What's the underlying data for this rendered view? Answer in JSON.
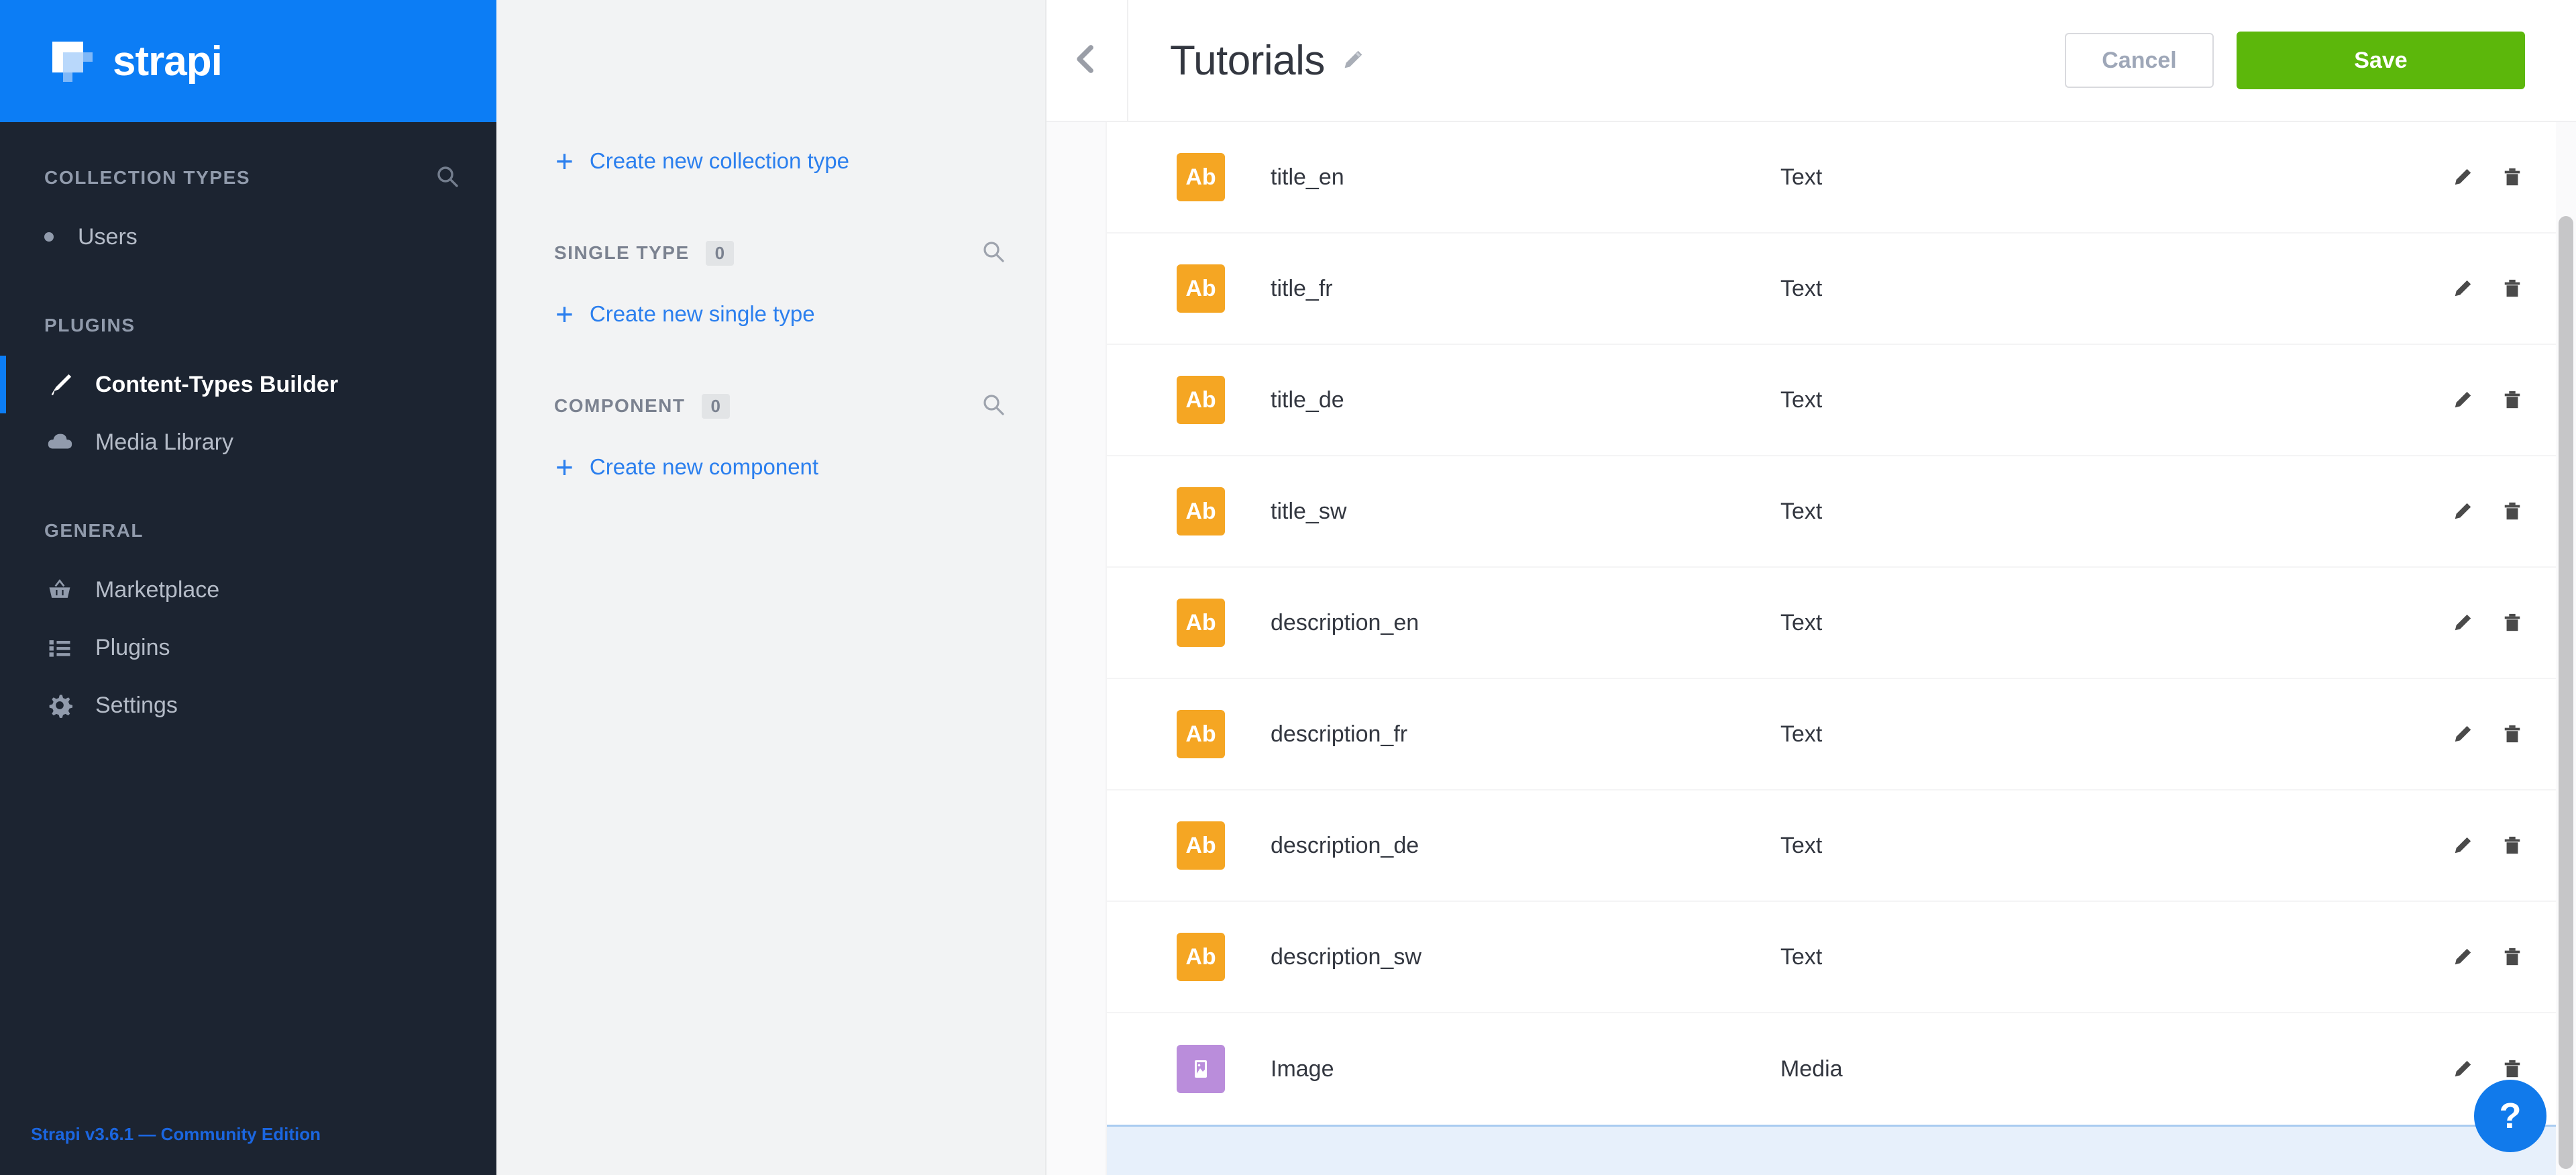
{
  "brand": {
    "name": "strapi",
    "logo_icon": "strapi-logo-icon",
    "header_color": "#0c7df5"
  },
  "sidebar": {
    "background": "#1c2431",
    "sections": [
      {
        "title": "COLLECTION TYPES",
        "search_icon": "search-icon",
        "items": [
          {
            "label": "Users",
            "icon": "bullet-dot-icon",
            "active": false
          }
        ]
      },
      {
        "title": "PLUGINS",
        "search_icon": null,
        "items": [
          {
            "label": "Content-Types Builder",
            "icon": "paintbrush-icon",
            "active": true
          },
          {
            "label": "Media Library",
            "icon": "cloud-upload-icon",
            "active": false
          }
        ]
      },
      {
        "title": "GENERAL",
        "search_icon": null,
        "items": [
          {
            "label": "Marketplace",
            "icon": "shopping-basket-icon",
            "active": false
          },
          {
            "label": "Plugins",
            "icon": "list-icon",
            "active": false
          },
          {
            "label": "Settings",
            "icon": "gear-icon",
            "active": false
          }
        ]
      }
    ],
    "footer": {
      "text": "Strapi v3.6.1 — Community Edition",
      "color": "#1b66e0"
    }
  },
  "types_panel": {
    "create_collection_type": "Create new collection type",
    "sections": [
      {
        "title": "SINGLE TYPE",
        "count": "0",
        "search_icon": "search-icon",
        "create_label": "Create new single type"
      },
      {
        "title": "COMPONENT",
        "count": "0",
        "search_icon": "search-icon",
        "create_label": "Create new component"
      }
    ]
  },
  "topbar": {
    "back_icon": "chevron-left-icon",
    "title": "Tutorials",
    "title_edit_icon": "pencil-edit-icon",
    "cancel_label": "Cancel",
    "save_label": "Save",
    "save_color": "#5cb70b"
  },
  "fields": {
    "rows": [
      {
        "name": "title_en",
        "type": "Text",
        "badge": "Ab",
        "badge_kind": "text",
        "badge_color": "#f5a623",
        "icon": "text-field-icon"
      },
      {
        "name": "title_fr",
        "type": "Text",
        "badge": "Ab",
        "badge_kind": "text",
        "badge_color": "#f5a623",
        "icon": "text-field-icon"
      },
      {
        "name": "title_de",
        "type": "Text",
        "badge": "Ab",
        "badge_kind": "text",
        "badge_color": "#f5a623",
        "icon": "text-field-icon"
      },
      {
        "name": "title_sw",
        "type": "Text",
        "badge": "Ab",
        "badge_kind": "text",
        "badge_color": "#f5a623",
        "icon": "text-field-icon"
      },
      {
        "name": "description_en",
        "type": "Text",
        "badge": "Ab",
        "badge_kind": "text",
        "badge_color": "#f5a623",
        "icon": "text-field-icon"
      },
      {
        "name": "description_fr",
        "type": "Text",
        "badge": "Ab",
        "badge_kind": "text",
        "badge_color": "#f5a623",
        "icon": "text-field-icon"
      },
      {
        "name": "description_de",
        "type": "Text",
        "badge": "Ab",
        "badge_kind": "text",
        "badge_color": "#f5a623",
        "icon": "text-field-icon"
      },
      {
        "name": "description_sw",
        "type": "Text",
        "badge": "Ab",
        "badge_kind": "text",
        "badge_color": "#f5a623",
        "icon": "text-field-icon"
      },
      {
        "name": "Image",
        "type": "Media",
        "badge": "",
        "badge_kind": "media",
        "badge_color": "#ba8ddb",
        "icon": "image-field-icon"
      }
    ],
    "row_edit_icon": "pencil-edit-icon",
    "row_delete_icon": "trash-delete-icon"
  },
  "help": {
    "label": "?",
    "icon": "question-mark-help-icon",
    "color": "#117aeb"
  }
}
